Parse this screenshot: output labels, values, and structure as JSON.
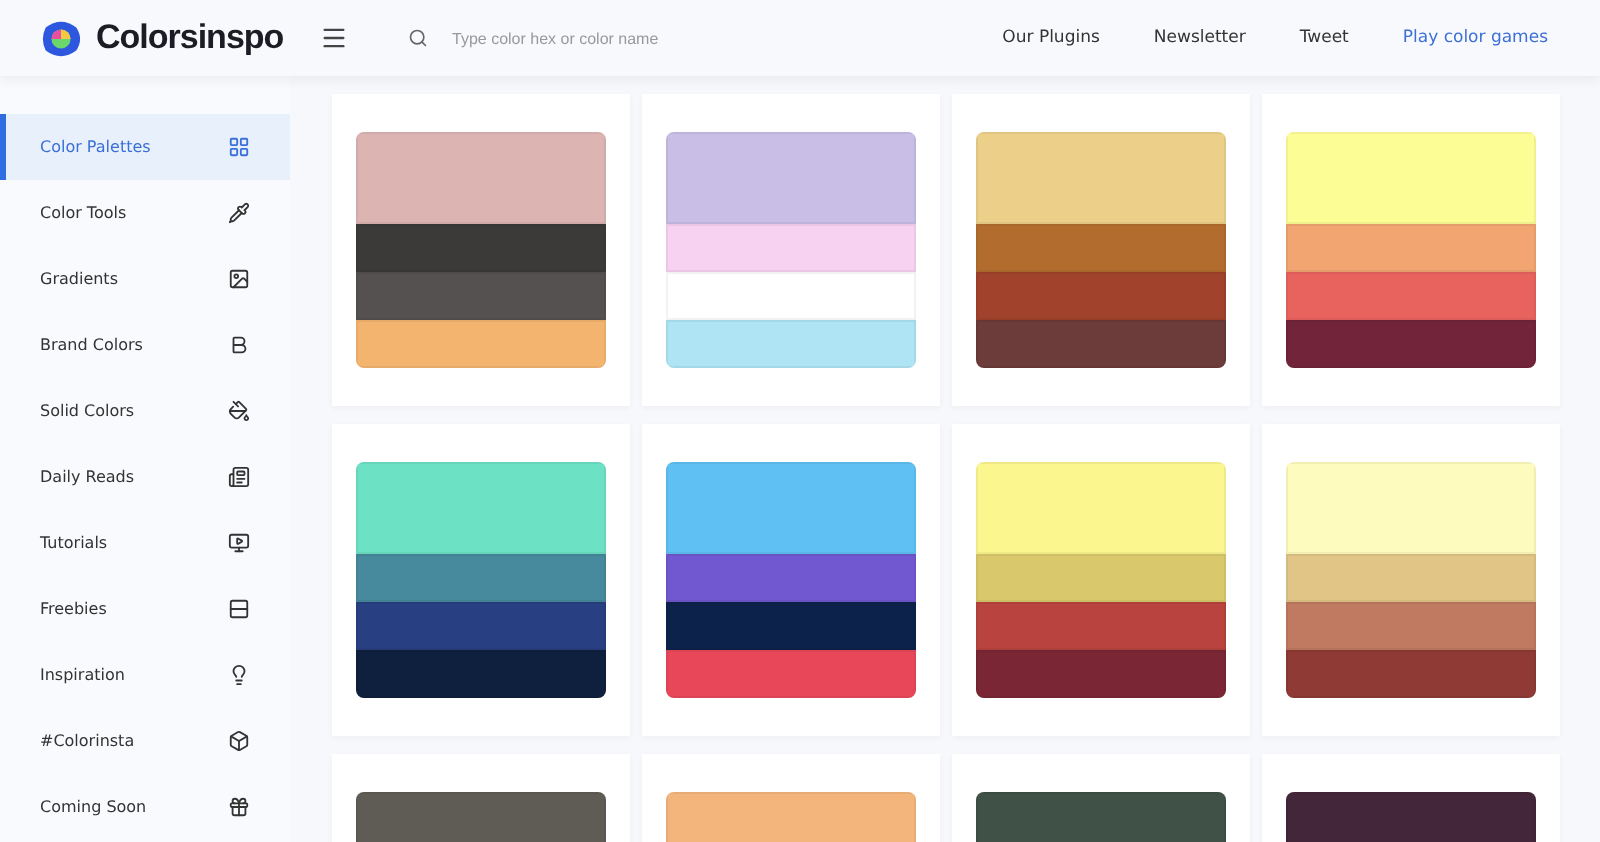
{
  "header": {
    "logo_text": "Colorsinspo",
    "search": {
      "placeholder": "Type color hex or color name"
    },
    "nav": [
      {
        "label": "Our Plugins",
        "kind": "plain"
      },
      {
        "label": "Newsletter",
        "kind": "plain"
      },
      {
        "label": "Tweet",
        "kind": "plain"
      },
      {
        "label": "Play color games",
        "kind": "accent"
      }
    ]
  },
  "sidebar": {
    "items": [
      {
        "label": "Color Palettes",
        "selected": true
      },
      {
        "label": "Color Tools",
        "selected": false
      },
      {
        "label": "Gradients",
        "selected": false
      },
      {
        "label": "Brand Colors",
        "selected": false
      },
      {
        "label": "Solid Colors",
        "selected": false
      },
      {
        "label": "Daily Reads",
        "selected": false
      },
      {
        "label": "Tutorials",
        "selected": false
      },
      {
        "label": "Freebies",
        "selected": false
      },
      {
        "label": "Inspiration",
        "selected": false
      },
      {
        "label": "#Colorinsta",
        "selected": false
      },
      {
        "label": "Coming Soon",
        "selected": false
      }
    ]
  },
  "palettes": [
    {
      "swatches": [
        {
          "color": "#dcb5b3"
        },
        {
          "color": "#3c3a38"
        },
        {
          "color": "#545150"
        },
        {
          "color": "#f3b46f"
        }
      ]
    },
    {
      "swatches": [
        {
          "color": "#c8bee6"
        },
        {
          "color": "#f7d3f1"
        },
        {
          "color": "#ffffff"
        },
        {
          "color": "#aee4f4"
        }
      ]
    },
    {
      "swatches": [
        {
          "color": "#ecd08a"
        },
        {
          "color": "#b26d2e"
        },
        {
          "color": "#a1422c"
        },
        {
          "color": "#6b3c39"
        }
      ]
    },
    {
      "swatches": [
        {
          "color": "#fdfd96"
        },
        {
          "color": "#f2a571"
        },
        {
          "color": "#e8635e"
        },
        {
          "color": "#71243a"
        }
      ]
    },
    {
      "swatches": [
        {
          "color": "#6de1c4"
        },
        {
          "color": "#478a9d"
        },
        {
          "color": "#283f81"
        },
        {
          "color": "#0f1f3e"
        }
      ]
    },
    {
      "swatches": [
        {
          "color": "#5fc0f3"
        },
        {
          "color": "#7158d1"
        },
        {
          "color": "#0c224a"
        },
        {
          "color": "#e8475a"
        }
      ]
    },
    {
      "swatches": [
        {
          "color": "#fcf68f"
        },
        {
          "color": "#dac96c"
        },
        {
          "color": "#b9433f"
        },
        {
          "color": "#7a2634"
        }
      ]
    },
    {
      "swatches": [
        {
          "color": "#fdfbbd"
        },
        {
          "color": "#e1c586"
        },
        {
          "color": "#c07a61"
        },
        {
          "color": "#8f3a35"
        }
      ]
    },
    {
      "swatches": [
        {
          "color": "#5e5c55"
        }
      ]
    },
    {
      "swatches": [
        {
          "color": "#f4b57d"
        }
      ]
    },
    {
      "swatches": [
        {
          "color": "#405148"
        }
      ]
    },
    {
      "swatches": [
        {
          "color": "#432639"
        }
      ]
    }
  ]
}
